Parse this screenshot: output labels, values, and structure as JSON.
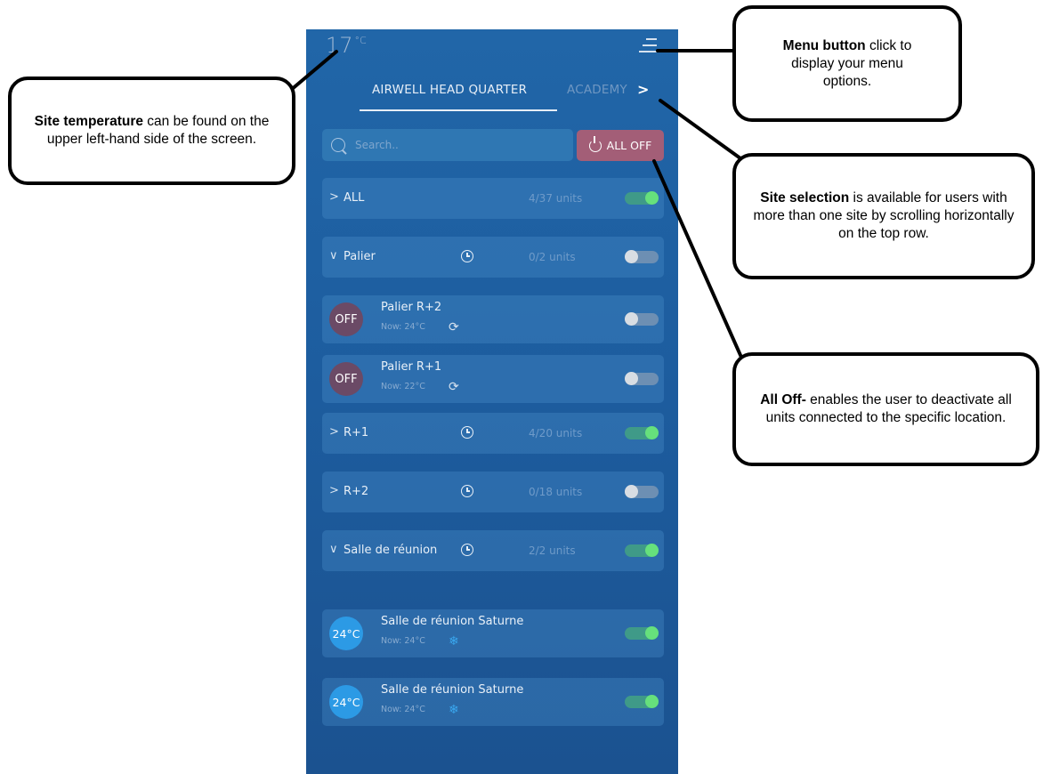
{
  "header": {
    "temperature": "17",
    "temperature_unit": "°C",
    "menu_icon": "menu-icon"
  },
  "tabs": {
    "active": "AIRWELL HEAD QUARTER",
    "next": "ACADEMY",
    "next_icon": "chevron-right-icon"
  },
  "search": {
    "placeholder": "Search.."
  },
  "all_off_button": {
    "label": "ALL OFF",
    "icon": "power-icon"
  },
  "groups": [
    {
      "name": "ALL",
      "caret": ">",
      "count": "4/37 units",
      "on": true
    },
    {
      "name": "Palier",
      "caret": "∨",
      "count": "0/2 units",
      "on": false,
      "schedule_icon": "clock-icon"
    },
    {
      "name": "R+1",
      "caret": ">",
      "count": "4/20 units",
      "on": true,
      "schedule_icon": "clock-icon"
    },
    {
      "name": "R+2",
      "caret": ">",
      "count": "0/18 units",
      "on": false,
      "schedule_icon": "clock-icon"
    },
    {
      "name": "Salle de réunion",
      "caret": "∨",
      "count": "2/2 units",
      "on": true,
      "schedule_icon": "clock-icon"
    }
  ],
  "units": [
    {
      "status": "OFF",
      "name": "Palier R+2",
      "now": "Now: 24°C",
      "mode_icon": "cycle-icon",
      "on": false
    },
    {
      "status": "OFF",
      "name": "Palier R+1",
      "now": "Now: 22°C",
      "mode_icon": "cycle-icon",
      "on": false
    },
    {
      "status": "24°C",
      "name": "Salle de réunion Saturne",
      "now": "Now: 24°C",
      "mode_icon": "snowflake-icon",
      "on": true
    },
    {
      "status": "24°C",
      "name": "Salle de réunion Saturne",
      "now": "Now: 24°C",
      "mode_icon": "snowflake-icon",
      "on": true
    }
  ],
  "callouts": {
    "temperature": {
      "bold": "Site temperature",
      "text": " can be found on the upper left-hand side of the screen."
    },
    "menu": {
      "bold": "Menu button",
      "text": " click to display your menu options."
    },
    "site": {
      "bold": "Site selection",
      "text": " is available for users with more than one site by scrolling horizontally on the top row."
    },
    "alloff": {
      "bold": "All Off-",
      "text": " enables the user to deactivate all units connected to the specific location."
    }
  }
}
